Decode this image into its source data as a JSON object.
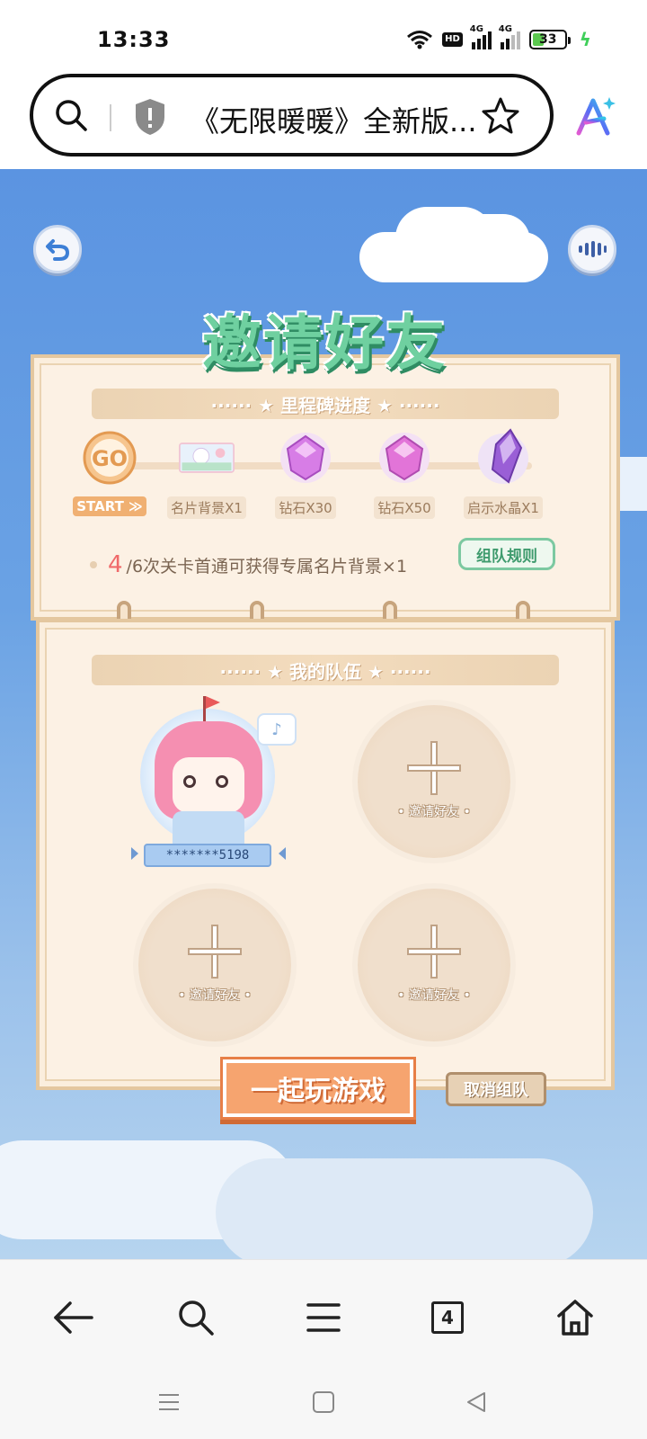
{
  "status": {
    "time": "13:33",
    "network_label": "4G",
    "hd_label": "HD",
    "battery": "33"
  },
  "browser": {
    "title": "《无限暖暖》全新版...",
    "search_icon": "search-icon",
    "shield_icon": "shield-icon",
    "bookmark_icon": "star-icon",
    "ai_icon": "ai-assistant-icon"
  },
  "game": {
    "title": "邀请好友",
    "milestone_header": "······ ★ 里程碑进度 ★ ······",
    "team_header": "······ ★ 我的队伍 ★ ······",
    "milestones": [
      {
        "icon": "go-badge",
        "icon_text": "GO",
        "label": "START ≫"
      },
      {
        "icon": "name-card-bg-icon",
        "label": "名片背景X1"
      },
      {
        "icon": "diamond-icon",
        "label": "钻石X30"
      },
      {
        "icon": "diamond-icon",
        "label": "钻石X50"
      },
      {
        "icon": "crystal-icon",
        "label": "启示水晶X1"
      }
    ],
    "progress": {
      "current": "4",
      "text": "/6次关卡首通可获得专属名片背景×1"
    },
    "rules_button": "组队规则",
    "player_name": "*******5198",
    "invite_label": "• 邀请好友 •",
    "play_button": "一起玩游戏",
    "cancel_button": "取消组队"
  },
  "colors": {
    "sky": "#6aa2e4",
    "panel": "#fcf1e4",
    "title_green": "#6fd0a0",
    "play_orange": "#f6a46f",
    "progress_red": "#f06a6a"
  },
  "nav": {
    "tab_count": "4"
  }
}
